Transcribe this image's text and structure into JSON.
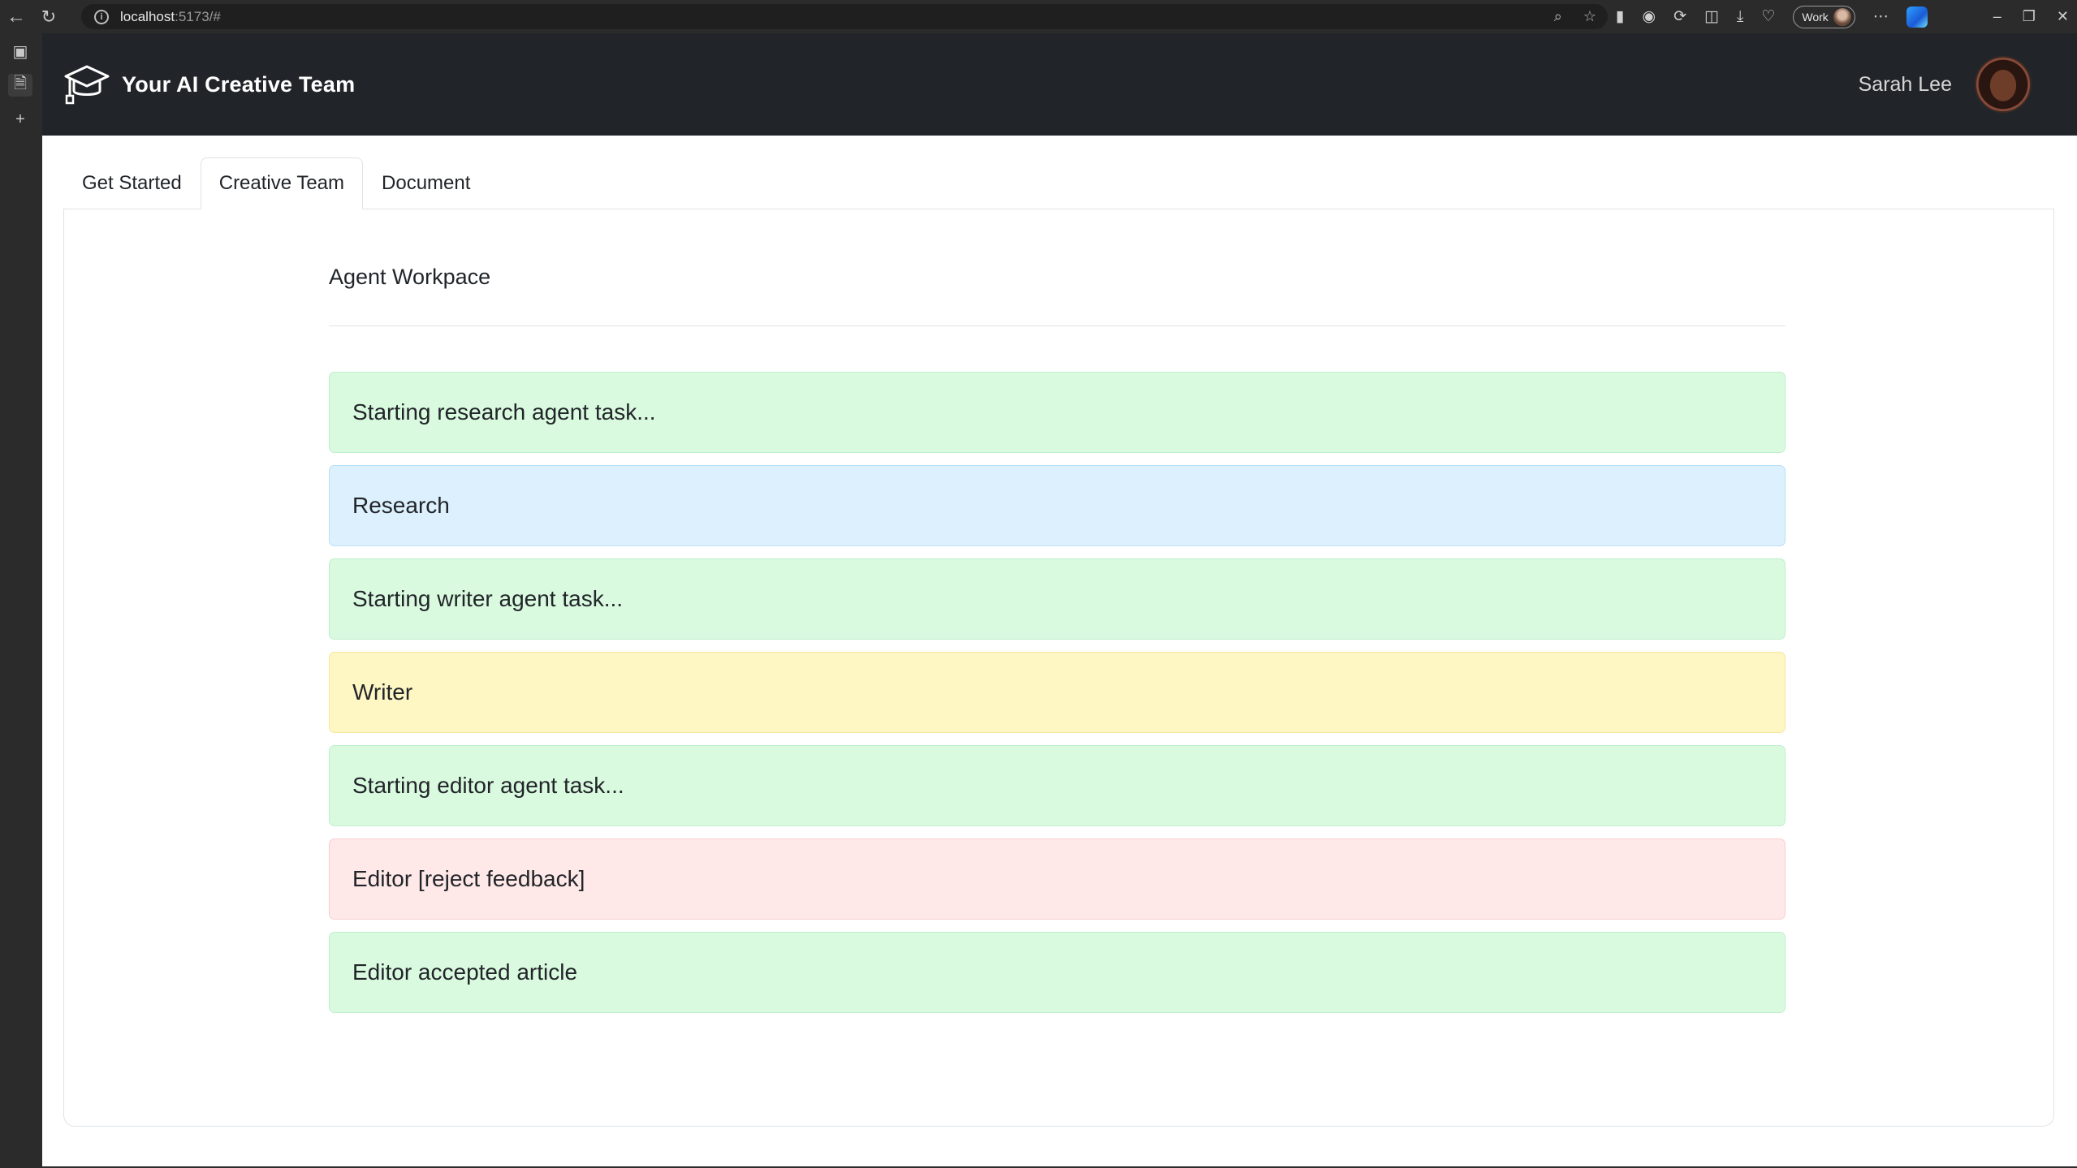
{
  "browser": {
    "url_host": "localhost",
    "url_path": ":5173/#",
    "profile_label": "Work"
  },
  "app": {
    "title": "Your AI Creative Team",
    "user_name": "Sarah Lee"
  },
  "tabs": [
    {
      "label": "Get Started",
      "active": false
    },
    {
      "label": "Creative Team",
      "active": true
    },
    {
      "label": "Document",
      "active": false
    }
  ],
  "workspace": {
    "title": "Agent Workpace",
    "messages": [
      {
        "text": "Starting research agent task...",
        "kind": "status"
      },
      {
        "text": "Research",
        "kind": "research"
      },
      {
        "text": "Starting writer agent task...",
        "kind": "status"
      },
      {
        "text": "Writer",
        "kind": "writer"
      },
      {
        "text": "Starting editor agent task...",
        "kind": "status"
      },
      {
        "text": "Editor [reject feedback]",
        "kind": "reject"
      },
      {
        "text": "Editor accepted article",
        "kind": "status"
      }
    ]
  },
  "colors": {
    "header_bg": "#212529",
    "status_bg": "#dafae0",
    "research_bg": "#dcf1fd",
    "writer_bg": "#fef6c3",
    "reject_bg": "#ffe8e8"
  }
}
